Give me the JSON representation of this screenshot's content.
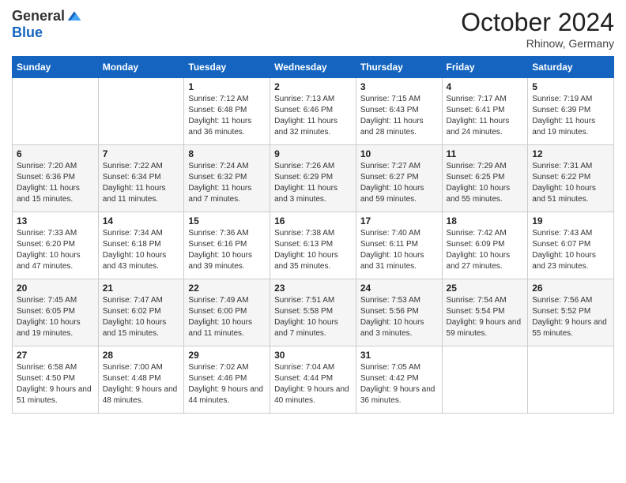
{
  "header": {
    "logo_general": "General",
    "logo_blue": "Blue",
    "month": "October 2024",
    "location": "Rhinow, Germany"
  },
  "weekdays": [
    "Sunday",
    "Monday",
    "Tuesday",
    "Wednesday",
    "Thursday",
    "Friday",
    "Saturday"
  ],
  "weeks": [
    [
      {
        "day": "",
        "info": ""
      },
      {
        "day": "",
        "info": ""
      },
      {
        "day": "1",
        "info": "Sunrise: 7:12 AM\nSunset: 6:48 PM\nDaylight: 11 hours and 36 minutes."
      },
      {
        "day": "2",
        "info": "Sunrise: 7:13 AM\nSunset: 6:46 PM\nDaylight: 11 hours and 32 minutes."
      },
      {
        "day": "3",
        "info": "Sunrise: 7:15 AM\nSunset: 6:43 PM\nDaylight: 11 hours and 28 minutes."
      },
      {
        "day": "4",
        "info": "Sunrise: 7:17 AM\nSunset: 6:41 PM\nDaylight: 11 hours and 24 minutes."
      },
      {
        "day": "5",
        "info": "Sunrise: 7:19 AM\nSunset: 6:39 PM\nDaylight: 11 hours and 19 minutes."
      }
    ],
    [
      {
        "day": "6",
        "info": "Sunrise: 7:20 AM\nSunset: 6:36 PM\nDaylight: 11 hours and 15 minutes."
      },
      {
        "day": "7",
        "info": "Sunrise: 7:22 AM\nSunset: 6:34 PM\nDaylight: 11 hours and 11 minutes."
      },
      {
        "day": "8",
        "info": "Sunrise: 7:24 AM\nSunset: 6:32 PM\nDaylight: 11 hours and 7 minutes."
      },
      {
        "day": "9",
        "info": "Sunrise: 7:26 AM\nSunset: 6:29 PM\nDaylight: 11 hours and 3 minutes."
      },
      {
        "day": "10",
        "info": "Sunrise: 7:27 AM\nSunset: 6:27 PM\nDaylight: 10 hours and 59 minutes."
      },
      {
        "day": "11",
        "info": "Sunrise: 7:29 AM\nSunset: 6:25 PM\nDaylight: 10 hours and 55 minutes."
      },
      {
        "day": "12",
        "info": "Sunrise: 7:31 AM\nSunset: 6:22 PM\nDaylight: 10 hours and 51 minutes."
      }
    ],
    [
      {
        "day": "13",
        "info": "Sunrise: 7:33 AM\nSunset: 6:20 PM\nDaylight: 10 hours and 47 minutes."
      },
      {
        "day": "14",
        "info": "Sunrise: 7:34 AM\nSunset: 6:18 PM\nDaylight: 10 hours and 43 minutes."
      },
      {
        "day": "15",
        "info": "Sunrise: 7:36 AM\nSunset: 6:16 PM\nDaylight: 10 hours and 39 minutes."
      },
      {
        "day": "16",
        "info": "Sunrise: 7:38 AM\nSunset: 6:13 PM\nDaylight: 10 hours and 35 minutes."
      },
      {
        "day": "17",
        "info": "Sunrise: 7:40 AM\nSunset: 6:11 PM\nDaylight: 10 hours and 31 minutes."
      },
      {
        "day": "18",
        "info": "Sunrise: 7:42 AM\nSunset: 6:09 PM\nDaylight: 10 hours and 27 minutes."
      },
      {
        "day": "19",
        "info": "Sunrise: 7:43 AM\nSunset: 6:07 PM\nDaylight: 10 hours and 23 minutes."
      }
    ],
    [
      {
        "day": "20",
        "info": "Sunrise: 7:45 AM\nSunset: 6:05 PM\nDaylight: 10 hours and 19 minutes."
      },
      {
        "day": "21",
        "info": "Sunrise: 7:47 AM\nSunset: 6:02 PM\nDaylight: 10 hours and 15 minutes."
      },
      {
        "day": "22",
        "info": "Sunrise: 7:49 AM\nSunset: 6:00 PM\nDaylight: 10 hours and 11 minutes."
      },
      {
        "day": "23",
        "info": "Sunrise: 7:51 AM\nSunset: 5:58 PM\nDaylight: 10 hours and 7 minutes."
      },
      {
        "day": "24",
        "info": "Sunrise: 7:53 AM\nSunset: 5:56 PM\nDaylight: 10 hours and 3 minutes."
      },
      {
        "day": "25",
        "info": "Sunrise: 7:54 AM\nSunset: 5:54 PM\nDaylight: 9 hours and 59 minutes."
      },
      {
        "day": "26",
        "info": "Sunrise: 7:56 AM\nSunset: 5:52 PM\nDaylight: 9 hours and 55 minutes."
      }
    ],
    [
      {
        "day": "27",
        "info": "Sunrise: 6:58 AM\nSunset: 4:50 PM\nDaylight: 9 hours and 51 minutes."
      },
      {
        "day": "28",
        "info": "Sunrise: 7:00 AM\nSunset: 4:48 PM\nDaylight: 9 hours and 48 minutes."
      },
      {
        "day": "29",
        "info": "Sunrise: 7:02 AM\nSunset: 4:46 PM\nDaylight: 9 hours and 44 minutes."
      },
      {
        "day": "30",
        "info": "Sunrise: 7:04 AM\nSunset: 4:44 PM\nDaylight: 9 hours and 40 minutes."
      },
      {
        "day": "31",
        "info": "Sunrise: 7:05 AM\nSunset: 4:42 PM\nDaylight: 9 hours and 36 minutes."
      },
      {
        "day": "",
        "info": ""
      },
      {
        "day": "",
        "info": ""
      }
    ]
  ]
}
